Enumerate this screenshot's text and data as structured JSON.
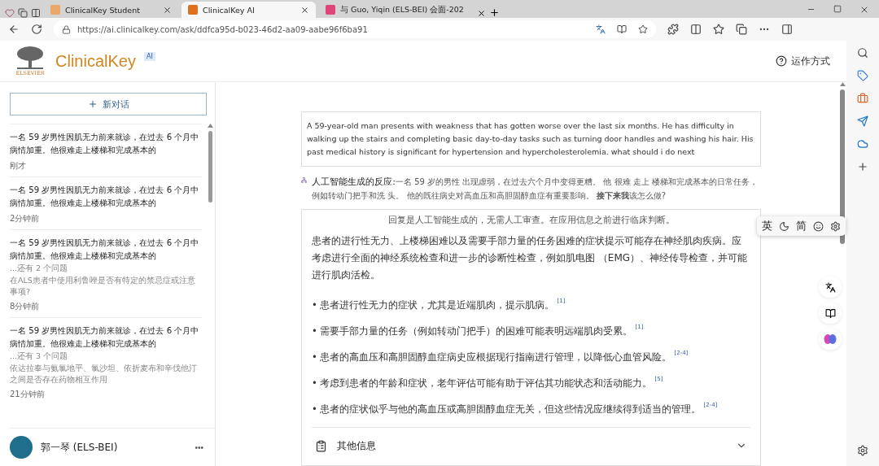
{
  "browser": {
    "tabs": [
      {
        "title": "ClinicalKey Student",
        "selected": false,
        "kind": "ck"
      },
      {
        "title": "ClinicalKey AI",
        "selected": true,
        "kind": "elsevier"
      },
      {
        "title": "与 Guo, Yiqin (ELS-BEI) 会面-202",
        "selected": false,
        "kind": "meeting"
      }
    ],
    "url": "https://ai.clinicalkey.com/ask/ddfca95d-b023-46d2-aa09-aabe96f6ba91"
  },
  "header": {
    "brand": "ClinicalKey",
    "publisher": "ELSEVIER",
    "badge": "AI",
    "help_link": "运作方式"
  },
  "sidebar": {
    "new_chat": "新对话",
    "conversations": [
      {
        "title": "一名 59 岁男性因肌无力前来就诊，在过去 6 个月中病情加重。他很难走上楼梯和完成基本的",
        "time": "刚才"
      },
      {
        "title": "一名 59 岁男性因肌无力前来就诊，在过去 6 个月中病情加重。他很难走上楼梯和完成基本的",
        "time": "2分钟前"
      },
      {
        "title": "一名 59 岁男性因肌无力前来就诊，在过去 6 个月中病情加重。他很难走上楼梯和完成基本的",
        "more": "...还有 2 个问题",
        "followup": "在ALS患者中使用利鲁唑是否有特定的禁忌症或注意事项?",
        "time": "8分钟前"
      },
      {
        "title": "一名 59 岁男性因肌无力前来就诊，在过去 6 个月中病情加重。他很难走上楼梯和完成基本的",
        "more": "...还有 3 个问题",
        "followup": "依达拉奉与氨氯地平、氯沙坦、依折麦布和辛伐他汀之间是否存在药物相互作用",
        "time": "21分钟前"
      }
    ],
    "user": {
      "name": "郭一琴 (ELS-BEI)",
      "menu": "•••"
    }
  },
  "question": "A 59-year-old man presents with weakness that has gotten worse over the last six months. He has difficulty in walking up the stairs and completing basic day-to-day tasks such as turning door handles and washing his hair. His past medical history is significant for hypertension and hypercholesterolemia. what should i do next",
  "ai_response": {
    "label": "人工智能生成的反应:",
    "text": "一名 59 岁的男性 出现虚弱，在过去六个月中变得更糟。 他 很难 走上 楼梯和完成基本的日常任务，例如转动门把手和洗 头。 他的既往病史对高血压和高胆固醇血症有重要影响。 **接下来我**该怎么做?"
  },
  "answer": {
    "bullet_mark": "•",
    "disclaimer": "回复是人工智能生成的，无需人工审查。在应用信息之前进行临床判断。",
    "summary": "患者的进行性无力、上楼梯困难以及需要手部力量的任务困难的症状提示可能存在神经肌肉疾病。应考虑进行全面的神经系统检查和进一步的诊断性检查，例如肌电图 （EMG）、神经传导检查，并可能进行肌肉活检。",
    "bullets": [
      {
        "text": "患者进行性无力的症状，尤其是近端肌肉，提示肌病。",
        "ref": "[1]"
      },
      {
        "text": "需要手部力量的任务（例如转动门把手）的困难可能表明远端肌肉受累。",
        "ref": "[1]"
      },
      {
        "text": "患者的高血压和高胆固醇血症病史应根据现行指南进行管理，以降低心血管风险。",
        "ref": "[2-4]"
      },
      {
        "text": "考虑到患者的年龄和症状，老年评估可能有助于评估其功能状态和活动能力。",
        "ref": "[5]"
      },
      {
        "text": "患者的症状似乎与他的高血压或高胆固醇血症无关，但这些情况应继续得到适当的管理。",
        "ref": "[2-4]"
      }
    ],
    "more_info": {
      "label": "其他信息",
      "expanded": false
    }
  },
  "ime_toolbar": {
    "language": "英",
    "script": "简"
  }
}
